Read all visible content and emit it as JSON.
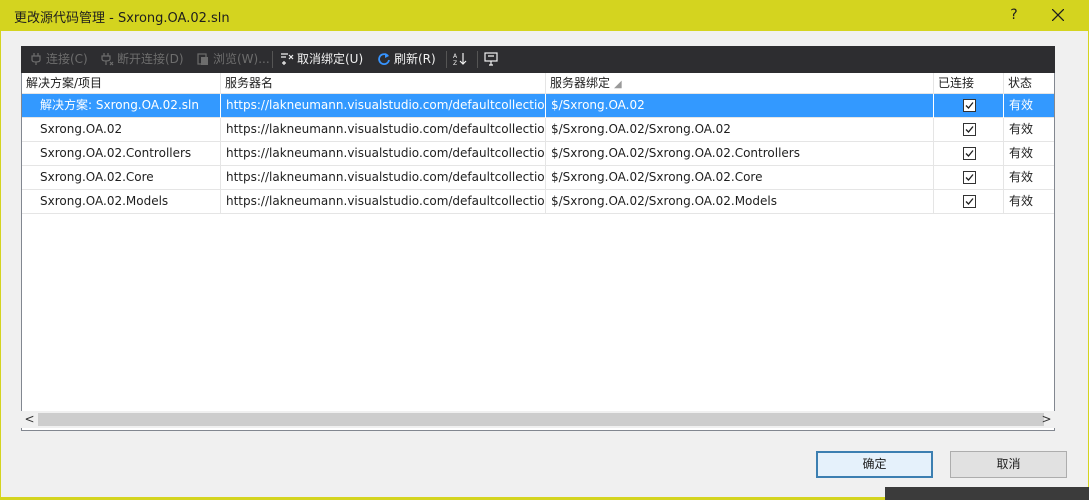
{
  "window": {
    "title": "更改源代码管理 - Sxrong.OA.02.sln",
    "help_label": "?",
    "close_label": "✕"
  },
  "toolbar": {
    "connect": "连接(C)",
    "disconnect": "断开连接(D)",
    "browse": "浏览(W)...",
    "unbind": "取消绑定(U)",
    "refresh": "刷新(R)"
  },
  "grid": {
    "columns": [
      "解决方案/项目",
      "服务器名",
      "服务器绑定",
      "已连接",
      "状态"
    ],
    "rows": [
      {
        "project": "解决方案: Sxrong.OA.02.sln",
        "server": "https://lakneumann.visualstudio.com/defaultcollection",
        "binding": "$/Sxrong.OA.02",
        "connected": true,
        "status": "有效",
        "selected": true
      },
      {
        "project": "Sxrong.OA.02",
        "server": "https://lakneumann.visualstudio.com/defaultcollection",
        "binding": "$/Sxrong.OA.02/Sxrong.OA.02",
        "connected": true,
        "status": "有效",
        "selected": false
      },
      {
        "project": "Sxrong.OA.02.Controllers",
        "server": "https://lakneumann.visualstudio.com/defaultcollection",
        "binding": "$/Sxrong.OA.02/Sxrong.OA.02.Controllers",
        "connected": true,
        "status": "有效",
        "selected": false
      },
      {
        "project": "Sxrong.OA.02.Core",
        "server": "https://lakneumann.visualstudio.com/defaultcollection",
        "binding": "$/Sxrong.OA.02/Sxrong.OA.02.Core",
        "connected": true,
        "status": "有效",
        "selected": false
      },
      {
        "project": "Sxrong.OA.02.Models",
        "server": "https://lakneumann.visualstudio.com/defaultcollection",
        "binding": "$/Sxrong.OA.02/Sxrong.OA.02.Models",
        "connected": true,
        "status": "有效",
        "selected": false
      }
    ]
  },
  "scroll": {
    "left": "<",
    "right": ">"
  },
  "buttons": {
    "ok": "确定",
    "cancel": "取消"
  },
  "colors": {
    "titlebar": "#d4d41f",
    "toolbar": "#2d2d30",
    "selection": "#3399ff"
  },
  "icons": [
    "plug-icon",
    "unplug-icon",
    "browse-icon",
    "unbind-icon",
    "refresh-icon",
    "sort-az-icon",
    "properties-icon",
    "checkbox-icon",
    "close-icon"
  ]
}
